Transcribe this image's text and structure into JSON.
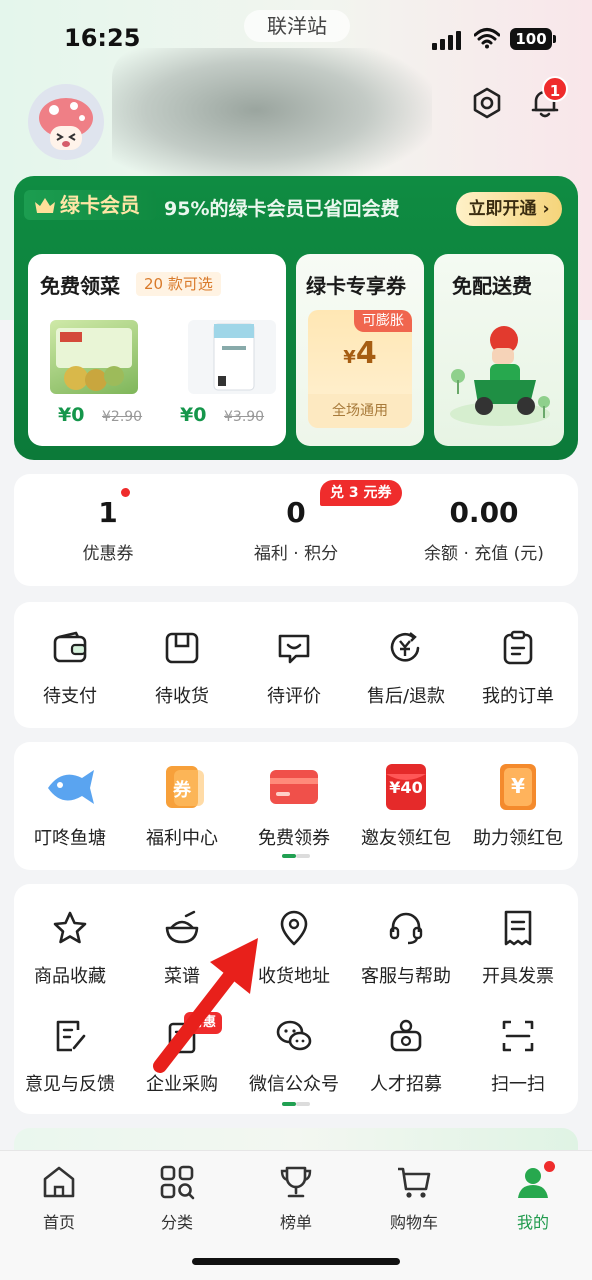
{
  "status": {
    "time": "16:25",
    "site": "联洋站",
    "battery": "100"
  },
  "header": {
    "notification_count": "1"
  },
  "vip": {
    "badge": "绿卡会员",
    "slogan": "95%的绿卡会员已省回会费",
    "cta": "立即开通 ›",
    "free_veg": {
      "title": "免费领菜",
      "tag": "20 款可选",
      "products": [
        {
          "price": "¥0",
          "old_price": "¥2.90"
        },
        {
          "price": "¥0",
          "old_price": "¥3.90"
        }
      ]
    },
    "coupon_card": {
      "title": "绿卡专享券",
      "inflate": "可膨胀",
      "currency": "¥",
      "amount": "4",
      "note": "全场通用"
    },
    "delivery_card": {
      "title": "免配送费"
    }
  },
  "stats": [
    {
      "value": "1",
      "label": "优惠券"
    },
    {
      "value": "0",
      "label": "福利 · 积分",
      "badge": "兑 3 元券"
    },
    {
      "value": "0.00",
      "label": "余额 · 充值 (元)"
    }
  ],
  "orders": [
    {
      "label": "待支付",
      "icon": "wallet-icon"
    },
    {
      "label": "待收货",
      "icon": "package-icon"
    },
    {
      "label": "待评价",
      "icon": "review-icon"
    },
    {
      "label": "售后/退款",
      "icon": "refund-icon"
    },
    {
      "label": "我的订单",
      "icon": "order-list-icon"
    }
  ],
  "promos": [
    {
      "label": "叮咚鱼塘",
      "icon": "fish-icon"
    },
    {
      "label": "福利中心",
      "icon": "voucher-icon",
      "glyph": "券"
    },
    {
      "label": "免费领券",
      "icon": "card-coupon-icon"
    },
    {
      "label": "邀友领红包",
      "icon": "red-envelope-icon",
      "glyph": "¥40"
    },
    {
      "label": "助力领红包",
      "icon": "yuan-envelope-icon",
      "glyph": "¥"
    }
  ],
  "services": [
    {
      "label": "商品收藏",
      "icon": "star-icon"
    },
    {
      "label": "菜谱",
      "icon": "bowl-icon"
    },
    {
      "label": "收货地址",
      "icon": "location-pin-icon"
    },
    {
      "label": "客服与帮助",
      "icon": "headset-icon"
    },
    {
      "label": "开具发票",
      "icon": "invoice-icon"
    },
    {
      "label": "意见与反馈",
      "icon": "feedback-icon"
    },
    {
      "label": "企业采购",
      "icon": "enterprise-icon",
      "tag": "特惠"
    },
    {
      "label": "微信公众号",
      "icon": "wechat-icon"
    },
    {
      "label": "人才招募",
      "icon": "recruit-icon"
    },
    {
      "label": "扫一扫",
      "icon": "scan-icon"
    }
  ],
  "tabs": [
    {
      "label": "首页",
      "icon": "home-icon"
    },
    {
      "label": "分类",
      "icon": "category-icon"
    },
    {
      "label": "榜单",
      "icon": "trophy-icon"
    },
    {
      "label": "购物车",
      "icon": "cart-icon"
    },
    {
      "label": "我的",
      "icon": "profile-icon",
      "active": true
    }
  ],
  "colors": {
    "brand_green": "#0f8c42",
    "price_green": "#15964b",
    "alert_red": "#ef2c2c",
    "active_tab": "#1f9a4c"
  }
}
